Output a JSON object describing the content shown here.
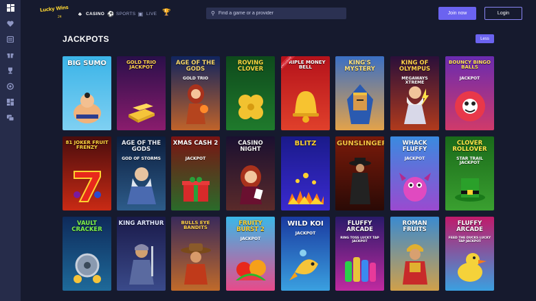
{
  "sidebar": {
    "icons": [
      "grid-icon",
      "heart-icon",
      "calendar-icon",
      "gift-icon",
      "trophy-icon",
      "chip-icon",
      "dashboard-icon",
      "chat-icon"
    ]
  },
  "header": {
    "logo_text": "Lucky Wins",
    "logo_sub": "24",
    "nav": [
      {
        "label": "CASINO",
        "icon": "club-icon",
        "active": true
      },
      {
        "label": "SPORTS",
        "icon": "ball-icon",
        "active": false
      },
      {
        "label": "LIVE",
        "icon": "live-icon",
        "active": false
      }
    ],
    "trophy_icon": "trophy-icon",
    "search_placeholder": "Find a game or a provider",
    "join_label": "Join now",
    "login_label": "Login"
  },
  "section": {
    "title": "JACKPOTS",
    "less_label": "Less"
  },
  "games": [
    {
      "title": "BIG SUMO",
      "sub": "",
      "bg": [
        "#3bb4e8",
        "#7fd0f2"
      ],
      "title_color": "#ffffff",
      "art": "sumo",
      "badge": ""
    },
    {
      "title": "GOLD TRIO JACKPOT",
      "sub": "",
      "bg": [
        "#2a0f4a",
        "#8a1c6d"
      ],
      "title_color": "#ffd34d",
      "art": "gold",
      "badge": ""
    },
    {
      "title": "AGE OF THE GODS",
      "sub": "GOLD TRIO",
      "bg": [
        "#10245e",
        "#c0632a"
      ],
      "title_color": "#f4d46a",
      "art": "goddess",
      "badge": ""
    },
    {
      "title": "ROVING CLOVER",
      "sub": "",
      "bg": [
        "#0e4a1c",
        "#1f7a2c"
      ],
      "title_color": "#f7d640",
      "art": "clover",
      "badge": ""
    },
    {
      "title": "TRIPLE MONEY BELL",
      "sub": "",
      "bg": [
        "#b5121b",
        "#e0402b"
      ],
      "title_color": "#ffffff",
      "art": "bell",
      "badge": "EXCLUSIVE"
    },
    {
      "title": "KING'S MYSTERY",
      "sub": "",
      "bg": [
        "#3a6fc4",
        "#e3a24a"
      ],
      "title_color": "#ffe27a",
      "art": "pharaoh",
      "badge": ""
    },
    {
      "title": "KING OF OLYMPUS",
      "sub": "MEGAWAYS XTREME",
      "bg": [
        "#2a0f3a",
        "#b03a1c"
      ],
      "title_color": "#ffd24a",
      "art": "zeus",
      "badge": ""
    },
    {
      "title": "BOUNCY BINGO BALLS",
      "sub": "JACKPOT",
      "bg": [
        "#6a2bb0",
        "#d03a6a"
      ],
      "title_color": "#ffe45a",
      "art": "ball",
      "badge": ""
    },
    {
      "title": "81 JOKER FRUIT FRENZY",
      "sub": "",
      "bg": [
        "#4a0d0d",
        "#c92a14"
      ],
      "title_color": "#ffd640",
      "art": "seven",
      "badge": ""
    },
    {
      "title": "AGE OF THE GODS",
      "sub": "GOD OF STORMS",
      "bg": [
        "#0c1e3e",
        "#2d5c8a"
      ],
      "title_color": "#e7ecf5",
      "art": "storm",
      "badge": ""
    },
    {
      "title": "XMAS CASH 2",
      "sub": "JACKPOT",
      "bg": [
        "#7a1313",
        "#2a6b2a"
      ],
      "title_color": "#ffffff",
      "art": "gift",
      "badge": ""
    },
    {
      "title": "CASINO NIGHT",
      "sub": "",
      "bg": [
        "#1a1030",
        "#5a2a2a"
      ],
      "title_color": "#f2f2f2",
      "art": "lady",
      "badge": ""
    },
    {
      "title": "BLITZ",
      "sub": "",
      "bg": [
        "#1a1a8a",
        "#3a2ad0"
      ],
      "title_color": "#ffd230",
      "art": "blitz",
      "badge": ""
    },
    {
      "title": "GUNSLINGER",
      "sub": "",
      "bg": [
        "#7a1a0a",
        "#2a0a06"
      ],
      "title_color": "#f2c040",
      "art": "gunman",
      "badge": ""
    },
    {
      "title": "WHACK FLUFFY",
      "sub": "JACKPOT",
      "bg": [
        "#3a8ae0",
        "#9a4ad0"
      ],
      "title_color": "#ffffff",
      "art": "dragon",
      "badge": ""
    },
    {
      "title": "CLOVER ROLLOVER",
      "sub": "STAR TRAIL JACKPOT",
      "bg": [
        "#1a6a1a",
        "#3aa030"
      ],
      "title_color": "#ffe84a",
      "art": "hat",
      "badge": ""
    },
    {
      "title": "VAULT CRACKER",
      "sub": "",
      "bg": [
        "#0e2a5a",
        "#1e6a9a"
      ],
      "title_color": "#7ef24a",
      "art": "vault",
      "badge": ""
    },
    {
      "title": "KING ARTHUR",
      "sub": "",
      "bg": [
        "#1a1a4a",
        "#3a4a8a"
      ],
      "title_color": "#e0e6ff",
      "art": "knight",
      "badge": ""
    },
    {
      "title": "BULLS EYE BANDITS",
      "sub": "",
      "bg": [
        "#3a2a5a",
        "#c06a2a"
      ],
      "title_color": "#ffd24a",
      "art": "cowboy",
      "badge": ""
    },
    {
      "title": "FRUITY BURST 2",
      "sub": "JACKPOT",
      "bg": [
        "#3ab8e8",
        "#e84a8a"
      ],
      "title_color": "#ffd230",
      "art": "fruit",
      "badge": ""
    },
    {
      "title": "WILD KOI",
      "sub": "JACKPOT",
      "bg": [
        "#1a3aa0",
        "#3aa0e0"
      ],
      "title_color": "#ffffff",
      "art": "koi",
      "badge": ""
    },
    {
      "title": "FLUFFY ARCADE",
      "sub": "RING TOSS LUCKY TAP JACKPOT",
      "bg": [
        "#2a1a6a",
        "#c02aa0"
      ],
      "title_color": "#ffffff",
      "art": "bottles",
      "badge": ""
    },
    {
      "title": "ROMAN FRUITS",
      "sub": "",
      "bg": [
        "#3a8ad0",
        "#d0a04a"
      ],
      "title_color": "#ffffff",
      "art": "roman",
      "badge": ""
    },
    {
      "title": "FLUFFY ARCADE",
      "sub": "FEED THE DUCKS LUCKY TAP JACKPOT",
      "bg": [
        "#c01a6a",
        "#3aa0e0"
      ],
      "title_color": "#ffffff",
      "art": "duck",
      "badge": ""
    }
  ]
}
